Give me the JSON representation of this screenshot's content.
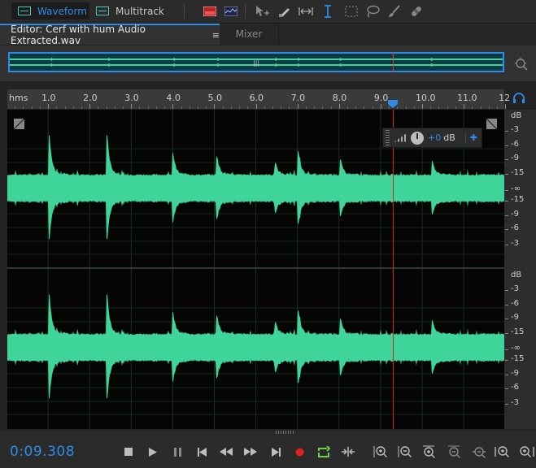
{
  "toolbar": {
    "waveform_label": "Waveform",
    "multitrack_label": "Multitrack",
    "tools": [
      "spectral-frequency-icon",
      "spectral-pitch-icon",
      "move-tool-icon",
      "razor-tool-icon",
      "slip-tool-icon",
      "time-selection-tool-icon",
      "marquee-tool-icon",
      "lasso-tool-icon",
      "brush-tool-icon",
      "spot-healing-icon"
    ]
  },
  "tabs": {
    "editor_label": "Editor: Cerf with hum Audio Extracted.wav",
    "editor_menu": "≡",
    "mixer_label": "Mixer"
  },
  "overview": {
    "handle": "|||",
    "playhead_fraction": 0.78
  },
  "ruler": {
    "unit_label": "hms",
    "labels": [
      "1.0",
      "2.0",
      "3.0",
      "4.0",
      "5.0",
      "6.0",
      "7.0",
      "8.0",
      "9.0",
      "10.0",
      "11.0",
      "12"
    ]
  },
  "hud": {
    "value": "+0",
    "unit": "dB"
  },
  "db_scale": {
    "channel1": [
      "dB",
      "-3",
      "-6",
      "-9",
      "-15",
      "-∞",
      "-15",
      "-9",
      "-6",
      "-3"
    ],
    "channel2": [
      "dB",
      "-3",
      "-6",
      "-9",
      "-15",
      "-∞",
      "-15",
      "-9",
      "-6",
      "-3"
    ]
  },
  "transport": {
    "time": "0:09.308",
    "buttons": [
      "stop-icon",
      "play-icon",
      "pause-icon",
      "move-to-previous-icon",
      "rewind-icon",
      "fast-forward-icon",
      "move-to-next-icon",
      "record-icon",
      "loop-playback-icon",
      "skip-selection-icon"
    ],
    "zoom_buttons": [
      "zoom-in-amplitude-icon",
      "zoom-out-amplitude-icon",
      "zoom-in-time-icon",
      "zoom-out-time-icon",
      "zoom-out-full-icon",
      "zoom-in-at-start-icon",
      "zoom-in-at-end-icon"
    ]
  },
  "colors": {
    "accent": "#2c8ce8",
    "waveform": "#3fd49a",
    "playhead": "#dd2222",
    "background": "#232323"
  }
}
